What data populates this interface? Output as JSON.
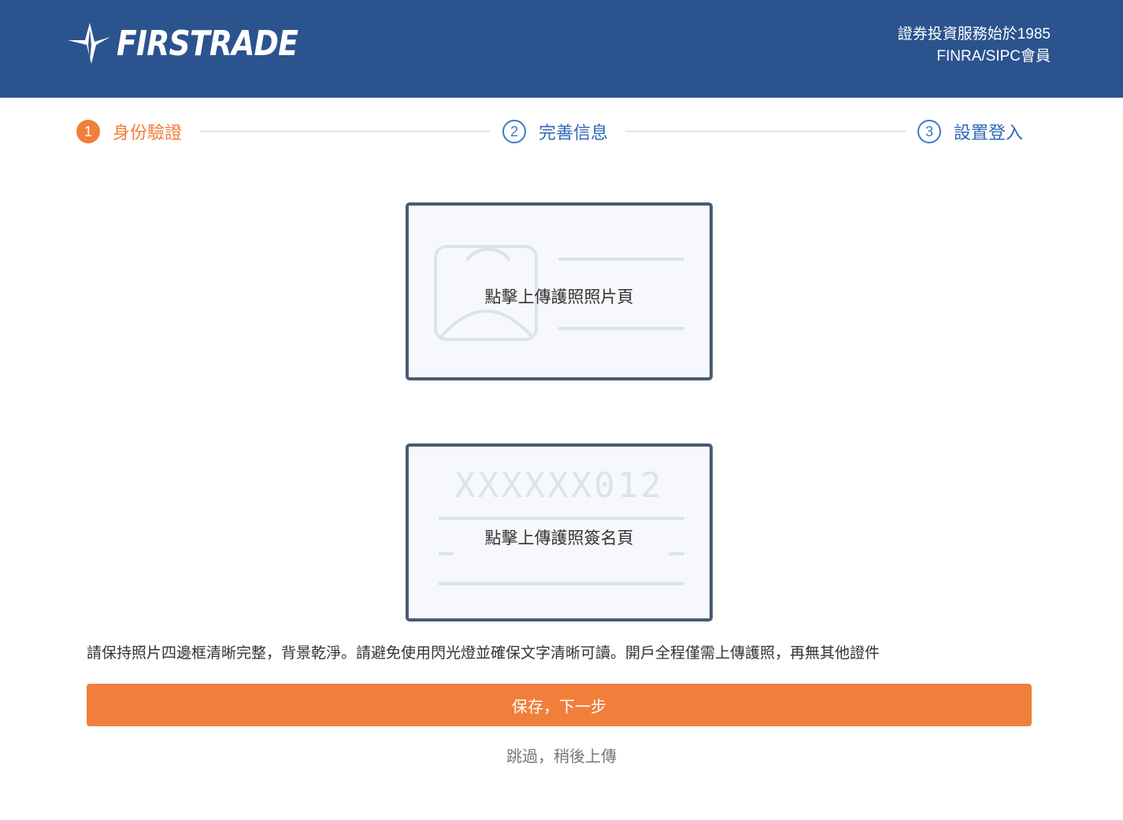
{
  "header": {
    "brand": "FIRSTRADE",
    "tagline_line1": "證券投資服務始於1985",
    "tagline_line2": "FINRA/SIPC會員",
    "background": "#2b538e"
  },
  "steps": [
    {
      "number": "1",
      "label": "身份驗證",
      "state": "active"
    },
    {
      "number": "2",
      "label": "完善信息",
      "state": "pending"
    },
    {
      "number": "3",
      "label": "設置登入",
      "state": "pending"
    }
  ],
  "upload": {
    "photo_page_label": "點擊上傳護照照片頁",
    "signature_page_label": "點擊上傳護照簽名頁",
    "signature_page_mrz": "XXXXXX012"
  },
  "notice": "請保持照片四邊框清晰完整，背景乾淨。請避免使用閃光燈並確保文字清晰可讀。開戶全程僅需上傳護照，再無其他證件",
  "actions": {
    "save_label": "保存，下一步",
    "skip_label": "跳過，稍後上傳"
  },
  "colors": {
    "accent": "#f07f3c",
    "step_pending": "#3d7ac7"
  },
  "icons": {
    "logo": "firstrade-arrow-logo",
    "photo_page": "passport-portrait-icon"
  }
}
